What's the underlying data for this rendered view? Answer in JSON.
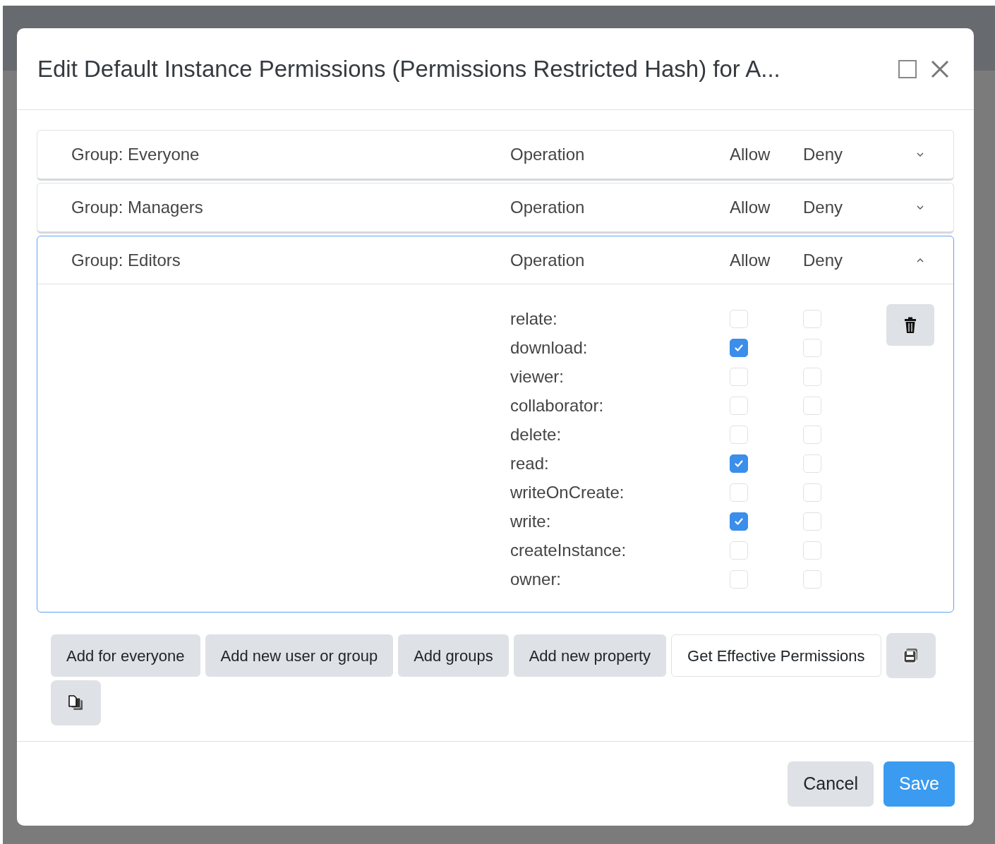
{
  "dialog": {
    "title": "Edit Default Instance Permissions (Permissions Restricted Hash) for A..."
  },
  "groups": [
    {
      "label": "Group: Everyone",
      "operation_header": "Operation",
      "allow_header": "Allow",
      "deny_header": "Deny",
      "expanded": false
    },
    {
      "label": "Group: Managers",
      "operation_header": "Operation",
      "allow_header": "Allow",
      "deny_header": "Deny",
      "expanded": false
    },
    {
      "label": "Group: Editors",
      "operation_header": "Operation",
      "allow_header": "Allow",
      "deny_header": "Deny",
      "expanded": true,
      "operations": [
        {
          "name": "relate:",
          "allow": false,
          "deny": false
        },
        {
          "name": "download:",
          "allow": true,
          "deny": false
        },
        {
          "name": "viewer:",
          "allow": false,
          "deny": false
        },
        {
          "name": "collaborator:",
          "allow": false,
          "deny": false
        },
        {
          "name": "delete:",
          "allow": false,
          "deny": false
        },
        {
          "name": "read:",
          "allow": true,
          "deny": false
        },
        {
          "name": "writeOnCreate:",
          "allow": false,
          "deny": false
        },
        {
          "name": "write:",
          "allow": true,
          "deny": false
        },
        {
          "name": "createInstance:",
          "allow": false,
          "deny": false
        },
        {
          "name": "owner:",
          "allow": false,
          "deny": false
        }
      ]
    }
  ],
  "actions": [
    {
      "label": "Add for everyone",
      "kind": "secondary"
    },
    {
      "label": "Add new user or group",
      "kind": "secondary"
    },
    {
      "label": "Add groups",
      "kind": "secondary"
    },
    {
      "label": "Add new property",
      "kind": "secondary"
    },
    {
      "label": "Get Effective Permissions",
      "kind": "outline"
    }
  ],
  "footer": [
    {
      "label": "Cancel",
      "kind": "secondary"
    },
    {
      "label": "Save",
      "kind": "primary"
    }
  ]
}
